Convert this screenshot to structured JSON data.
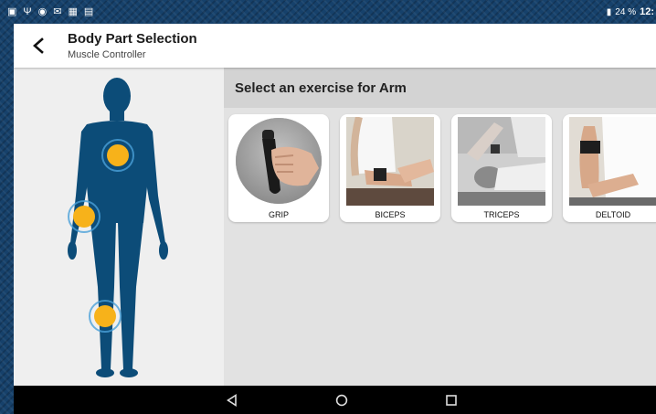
{
  "status_bar": {
    "battery": "24 %",
    "time": "12:"
  },
  "header": {
    "title": "Body Part Selection",
    "subtitle": "Muscle Controller"
  },
  "main": {
    "prompt": "Select an exercise for Arm",
    "exercises": [
      {
        "label": "GRIP"
      },
      {
        "label": "BICEPS"
      },
      {
        "label": "TRICEPS"
      },
      {
        "label": "DELTOID"
      }
    ]
  },
  "colors": {
    "body": "#0c4c78",
    "marker": "#f7b21a",
    "marker_ring": "#4aa0d8"
  },
  "icons": {
    "back": "back-arrow-icon",
    "nav": [
      "back-triangle-icon",
      "home-circle-icon",
      "recents-square-icon"
    ]
  }
}
